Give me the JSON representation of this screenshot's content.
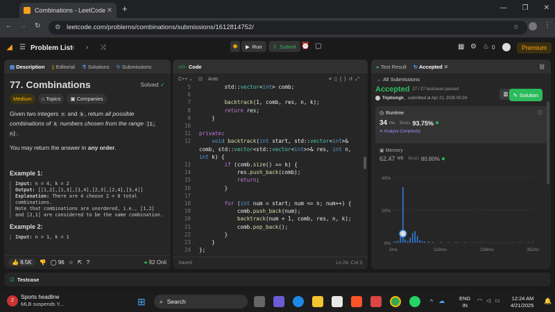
{
  "browser": {
    "tab_title": "Combinations - LeetCode",
    "url": "leetcode.com/problems/combinations/submissions/1612814752/"
  },
  "lc_header": {
    "problem_list": "Problem List",
    "run": "Run",
    "submit": "Submit",
    "streak": "0",
    "premium": "Premium"
  },
  "left_panel": {
    "tabs": [
      "Description",
      "Editorial",
      "Solutions",
      "Submissions"
    ],
    "title": "77. Combinations",
    "solved": "Solved",
    "difficulty": "Medium",
    "topics": "Topics",
    "companies": "Companies",
    "para1_a": "Given two integers ",
    "para1_n": "n",
    "para1_b": " and ",
    "para1_k": "k",
    "para1_c": ", return ",
    "para1_d": "all possible combinations of ",
    "para1_e": " numbers chosen from the range ",
    "para1_range": "[1, n]",
    "para1_end": ".",
    "para2_a": "You may return the answer in ",
    "para2_b": "any order",
    "para2_c": ".",
    "ex1_title": "Example 1:",
    "ex1_input_label": "Input:",
    "ex1_input": " n = 4, k = 2",
    "ex1_output_label": "Output:",
    "ex1_output": " [[1,2],[1,3],[1,4],[2,3],[2,4],[3,4]]",
    "ex1_expl_label": "Explanation:",
    "ex1_expl": " There are 4 choose 2 = 6 total combinations.",
    "ex1_note": "Note that combinations are unordered, i.e., [1,2] and [2,1] are considered to be the same combination.",
    "ex2_title": "Example 2:",
    "ex2_input_label": "Input:",
    "ex2_input": " n = 1, k = 1",
    "likes": "8.5K",
    "comments": "96",
    "online": "92 Onli"
  },
  "code_panel": {
    "title": "Code",
    "lang": "C++",
    "mode": "Auto",
    "saved": "Saved",
    "cursor": "Ln 24, Col 3",
    "lines": [
      {
        "n": "5",
        "t": "        std::vector<int> comb;"
      },
      {
        "n": "6",
        "t": ""
      },
      {
        "n": "7",
        "t": "        backtrack(1, comb, res, n, k);"
      },
      {
        "n": "8",
        "t": "        return res;"
      },
      {
        "n": "9",
        "t": "    }"
      },
      {
        "n": "10",
        "t": ""
      },
      {
        "n": "11",
        "t": "private:"
      },
      {
        "n": "12",
        "t": "    void backtrack(int start, std::vector<int>&"
      },
      {
        "n": "",
        "t": "comb, std::vector<std::vector<int>>& res, int n,"
      },
      {
        "n": "",
        "t": "int k) {"
      },
      {
        "n": "13",
        "t": "        if (comb.size() == k) {"
      },
      {
        "n": "14",
        "t": "            res.push_back(comb);"
      },
      {
        "n": "15",
        "t": "            return;"
      },
      {
        "n": "16",
        "t": "        }"
      },
      {
        "n": "17",
        "t": ""
      },
      {
        "n": "18",
        "t": "        for (int num = start; num <= n; num++) {"
      },
      {
        "n": "19",
        "t": "            comb.push_back(num);"
      },
      {
        "n": "20",
        "t": "            backtrack(num + 1, comb, res, n, k);"
      },
      {
        "n": "21",
        "t": "            comb.pop_back();"
      },
      {
        "n": "22",
        "t": "        }"
      },
      {
        "n": "23",
        "t": "    }"
      },
      {
        "n": "24",
        "t": "};"
      }
    ]
  },
  "result_panel": {
    "tabs": [
      "Test Result",
      "Accepted"
    ],
    "all_submissions": "All Submissions",
    "status": "Accepted",
    "testcases": "27 / 27 testcases passed",
    "user": "Triptisingh_",
    "submitted": "submitted at Apr 21, 2025 00:24",
    "solution_btn": "Solution",
    "runtime_label": "Runtime",
    "runtime_value": "34",
    "runtime_unit": "ms",
    "beats_label": "Beats",
    "runtime_beats": "93.75%",
    "analyze": "Analyze Complexity",
    "memory_label": "Memory",
    "memory_value": "62.47",
    "memory_unit": "MB",
    "memory_beats": "80.80%",
    "y_labels": [
      "40%",
      "20%",
      "0%"
    ],
    "x_labels": [
      "2ms",
      "119ms",
      "236ms",
      "352ms"
    ]
  },
  "testcase": "Testcase",
  "taskbar": {
    "news_title": "Sports headline",
    "news_sub": "MLB suspends Y...",
    "search": "Search",
    "lang": "ENG",
    "region": "IN",
    "time": "12:24 AM",
    "date": "4/21/2025"
  },
  "chart_data": {
    "type": "bar",
    "title": "",
    "xlabel": "",
    "ylabel": "",
    "x_tick_labels": [
      "2ms",
      "119ms",
      "236ms",
      "352ms"
    ],
    "y_tick_labels": [
      "40%",
      "20%",
      "0%"
    ],
    "ylim": [
      0,
      45
    ],
    "x": [
      2,
      8,
      14,
      20,
      26,
      32,
      38,
      44,
      50,
      56,
      62,
      68,
      74,
      80,
      90,
      100,
      120,
      140,
      160,
      180,
      200,
      220,
      240,
      260,
      280,
      300,
      320,
      340,
      352
    ],
    "values": [
      0.3,
      0.8,
      1.2,
      4.0,
      34.0,
      2.0,
      1.0,
      3.0,
      6.0,
      7.0,
      4.0,
      1.5,
      1.0,
      0.8,
      0.6,
      0.5,
      0.4,
      0.3,
      0.3,
      0.3,
      0.2,
      0.2,
      0.2,
      0.2,
      0.2,
      0.2,
      0.2,
      0.2,
      0.3
    ]
  }
}
